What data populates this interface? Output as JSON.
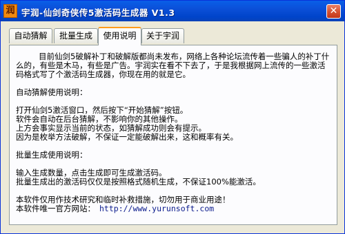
{
  "window": {
    "title": "宇润-仙剑奇侠传5激活码生成器 V1.3",
    "icon": "app-logo-icon",
    "close_glyph": "✕"
  },
  "tabs": [
    {
      "label": "自动猜解",
      "active": false
    },
    {
      "label": "批量生成",
      "active": false
    },
    {
      "label": "使用说明",
      "active": true
    },
    {
      "label": "关于宇润",
      "active": false
    }
  ],
  "content": {
    "intro": "目前仙剑5破解补丁和破解版都尚未发布，网络上各种论坛流传着一些骗人的补丁什么的，有些是木马，有些是广告。宇润实在看不下去了，于是我根据网上流传的一些激活码格式写了个激活码生成器，你现在用的就是它。",
    "auto_heading": "自动猜解使用说明：",
    "auto_lines": [
      "打开仙剑5激活窗口，然后按下“开始猜解”按钮。",
      "软件会自动在后台猜解，不影响你的其他操作。",
      "上方会事实显示当前的状态，如猜解成功则会有提示。",
      "因为是枚举方法破解，不保证一定能破解出来，这和概率有关。"
    ],
    "batch_heading": "批量生成使用说明：",
    "batch_lines": [
      "输入生成数量，点击生成即可生成激活码。",
      "批量生成出的激活码仅仅是按照格式随机生成，不保证100%能激活。"
    ],
    "disclaimer": "本软件仅用作技术研究和临时补救措施，切勿用于商业用途！",
    "site_label": "本软件唯一官方网站：",
    "site_url": "http://www.yurunsoft.com"
  },
  "colors": {
    "titlebar": "#0b4fd8",
    "active_tab_accent": "#ff9b1a",
    "close_button": "#d4502f"
  }
}
